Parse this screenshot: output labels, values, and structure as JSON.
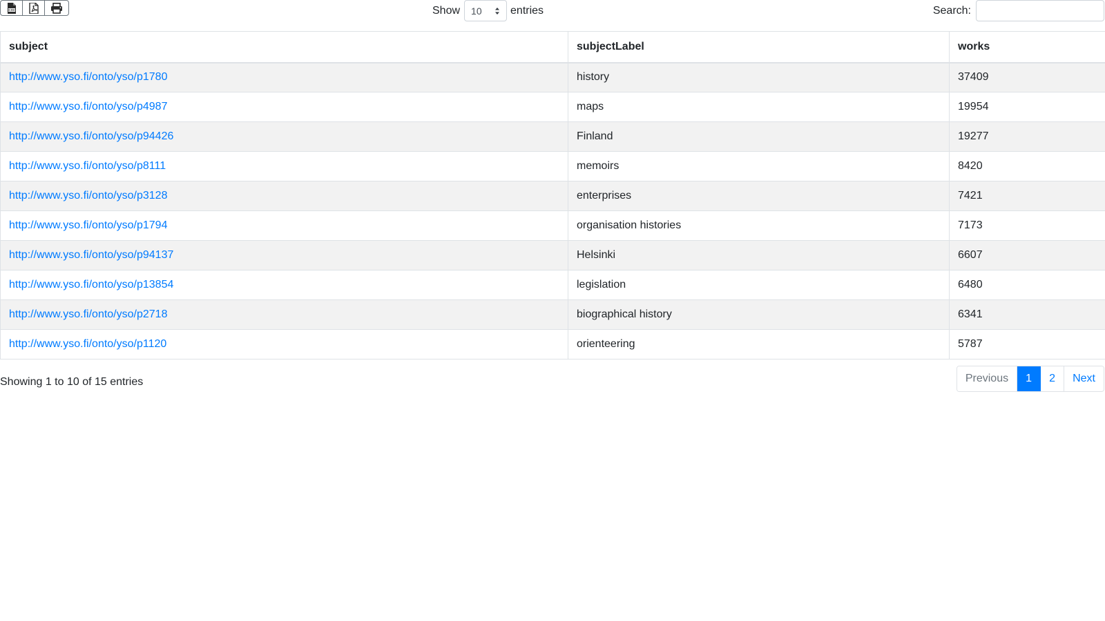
{
  "toolbar": {
    "export_buttons": [
      {
        "name": "csv-icon",
        "label": "CSV"
      },
      {
        "name": "pdf-icon",
        "label": "PDF"
      },
      {
        "name": "print-icon",
        "label": "Print"
      }
    ],
    "show_label": "Show",
    "page_length": "10",
    "entries_label": "entries",
    "search_label": "Search:",
    "search_value": "",
    "search_placeholder": ""
  },
  "table": {
    "columns": [
      "subject",
      "subjectLabel",
      "works"
    ],
    "rows": [
      {
        "subject": "http://www.yso.fi/onto/yso/p1780",
        "subjectLabel": "history",
        "works": "37409"
      },
      {
        "subject": "http://www.yso.fi/onto/yso/p4987",
        "subjectLabel": "maps",
        "works": "19954"
      },
      {
        "subject": "http://www.yso.fi/onto/yso/p94426",
        "subjectLabel": "Finland",
        "works": "19277"
      },
      {
        "subject": "http://www.yso.fi/onto/yso/p8111",
        "subjectLabel": "memoirs",
        "works": "8420"
      },
      {
        "subject": "http://www.yso.fi/onto/yso/p3128",
        "subjectLabel": "enterprises",
        "works": "7421"
      },
      {
        "subject": "http://www.yso.fi/onto/yso/p1794",
        "subjectLabel": "organisation histories",
        "works": "7173"
      },
      {
        "subject": "http://www.yso.fi/onto/yso/p94137",
        "subjectLabel": "Helsinki",
        "works": "6607"
      },
      {
        "subject": "http://www.yso.fi/onto/yso/p13854",
        "subjectLabel": "legislation",
        "works": "6480"
      },
      {
        "subject": "http://www.yso.fi/onto/yso/p2718",
        "subjectLabel": "biographical history",
        "works": "6341"
      },
      {
        "subject": "http://www.yso.fi/onto/yso/p1120",
        "subjectLabel": "orienteering",
        "works": "5787"
      }
    ]
  },
  "footer": {
    "info": "Showing 1 to 10 of 15 entries",
    "previous_label": "Previous",
    "pages": [
      "1",
      "2"
    ],
    "active_page": "1",
    "next_label": "Next"
  },
  "colors": {
    "link": "#007bff",
    "active_page_bg": "#007bff",
    "striped_row_bg": "#f2f2f2",
    "border": "#dee2e6"
  }
}
